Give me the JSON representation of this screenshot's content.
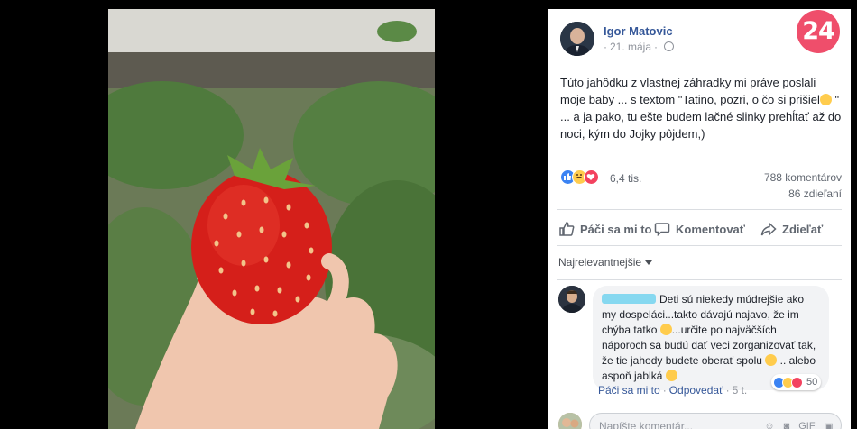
{
  "post": {
    "author": "Igor Matovic",
    "date": "21. mája",
    "date_dot": "·",
    "text": "Túto jahôdku z vlastnej záhradky mi práve poslali moje baby ... s textom \"Tatino, pozri, o čo si prišiel",
    "text_after_emoji": " \" ... a ja pako, tu ešte budem lačné slinky prehĺtať až do noci, kým do Jojky pôjdem,)",
    "reaction_count": "6,4 tis.",
    "comments_count": "788 komentárov",
    "shares_count": "86 zdieľaní"
  },
  "badge": {
    "text": "24",
    "color": "#ef4e6b"
  },
  "actions": {
    "like_label": "Páči sa mi to",
    "comment_label": "Komentovať",
    "share_label": "Zdieľať"
  },
  "comments_sort": {
    "label": "Najrelevantnejšie"
  },
  "comment": {
    "line1": "Deti sú niekedy múdrejšie ako my dospeláci...takto dávajú najavo, že im chýba tatko ",
    "line2": "...určite po najväčších náporoch sa budú dať veci zorganizovať tak, že tie jahody budete oberať spolu ",
    "line3": " .. alebo aspoň jablká ",
    "reaction_count": "50",
    "like_label": "Páči sa mi to",
    "reply_label": "Odpovedať",
    "separator": "·",
    "age": "5 t."
  },
  "composer": {
    "placeholder": "Napíšte komentár...",
    "icons": [
      "emoji-icon",
      "camera-icon",
      "gif-icon",
      "sticker-icon"
    ],
    "gif_label": "GIF"
  },
  "colors": {
    "link": "#365899",
    "like": "#3b83f3",
    "haha": "#ffcc4d",
    "love": "#f3425f",
    "redaction": "#86d8f0"
  }
}
